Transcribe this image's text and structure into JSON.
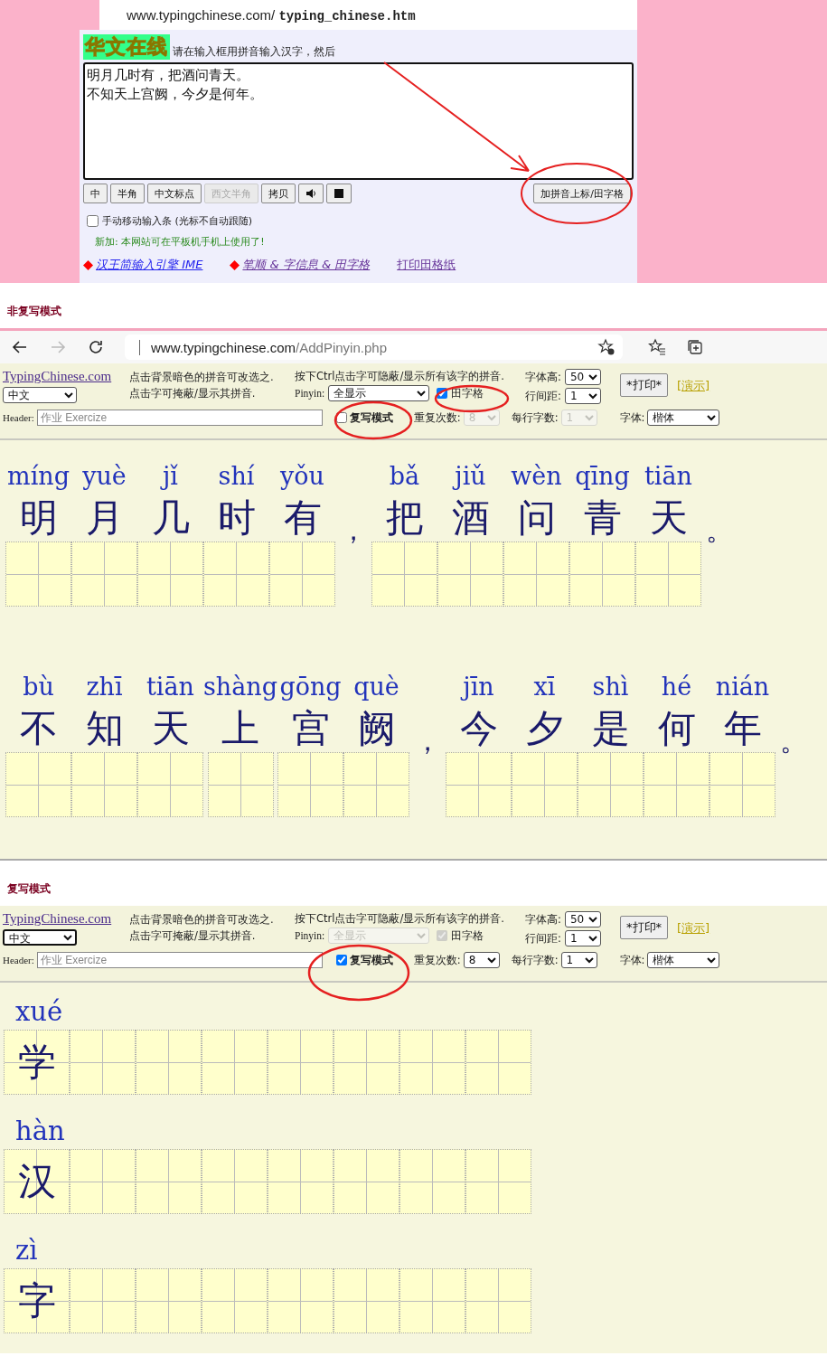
{
  "top": {
    "url_host": "www.typingchinese.com/ ",
    "url_file": "typing_chinese.htm",
    "logo": "华文在线",
    "instruction": "请在输入框用拼音输入汉字，然后",
    "text_lines": [
      "明月几时有，把酒问青天。",
      "不知天上宫阙，今夕是何年。"
    ],
    "buttons": [
      {
        "kind": "text",
        "label": "中",
        "disabled": false
      },
      {
        "kind": "text",
        "label": "半角",
        "disabled": false
      },
      {
        "kind": "text",
        "label": "中文标点",
        "disabled": false
      },
      {
        "kind": "text",
        "label": "西文半角",
        "disabled": true
      },
      {
        "kind": "text",
        "label": "拷贝",
        "disabled": false
      },
      {
        "kind": "speaker",
        "disabled": false
      },
      {
        "kind": "stop",
        "disabled": false
      }
    ],
    "add_button": "加拼音上标/田字格",
    "manual_move": {
      "label": "手动移动输入条 (光标不自动跟随)",
      "checked": false
    },
    "notice": "新加: 本网站可在平板机手机上使用了!",
    "links": [
      {
        "text": "汉王简输入引擎 IME",
        "marked": true
      },
      {
        "text": "笔顺 & 字信息 & 田字格",
        "marked": true
      },
      {
        "text": "打印田格纸",
        "marked": false
      }
    ]
  },
  "sections": [
    {
      "heading": "非复写模式",
      "browser": {
        "url_host": "www.typingchinese.com",
        "url_path": "/AddPinyin.php"
      },
      "toolbar": {
        "site_link": "TypingChinese.com",
        "language": {
          "value": "中文",
          "focused": false
        },
        "hint_1": "点击背景暗色的拼音可改选之.",
        "hint_2": "点击字可掩蔽/显示其拼音.",
        "ctrl_hint": "按下Ctrl点击字可隐蔽/显示所有该字的拼音.",
        "pinyin_label": "Pinyin:",
        "pinyin_mode": {
          "value": "全显示",
          "disabled": false
        },
        "grid_box": {
          "label": "田字格",
          "checked": true,
          "disabled": false
        },
        "font_size_label": "字体高:",
        "font_size": "50",
        "line_spacing_label": "行间距:",
        "line_spacing": "1",
        "print_button": "*打印*",
        "demo_link": "[演示]",
        "header_label": "Header:",
        "header_field": {
          "placeholder": "作业 Exercize"
        },
        "copy_mode": {
          "label": "复写模式",
          "checked": false
        },
        "repeat_label": "重复次数:",
        "repeat": {
          "value": "8",
          "disabled": true
        },
        "per_line_label": "每行字数:",
        "per_line": {
          "value": "1",
          "disabled": true
        },
        "font_label": "字体:",
        "font": "楷体"
      },
      "lines": [
        [
          {
            "kind": "hanzi",
            "pinyin": "míng",
            "char": "明"
          },
          {
            "kind": "hanzi",
            "pinyin": "yuè",
            "char": "月"
          },
          {
            "kind": "hanzi",
            "pinyin": "jǐ",
            "char": "几"
          },
          {
            "kind": "hanzi",
            "pinyin": "shí",
            "char": "时"
          },
          {
            "kind": "hanzi",
            "pinyin": "yǒu",
            "char": "有"
          },
          {
            "kind": "punct",
            "char": "，"
          },
          {
            "kind": "hanzi",
            "pinyin": "bǎ",
            "char": "把"
          },
          {
            "kind": "hanzi",
            "pinyin": "jiǔ",
            "char": "酒"
          },
          {
            "kind": "hanzi",
            "pinyin": "wèn",
            "char": "问"
          },
          {
            "kind": "hanzi",
            "pinyin": "qīng",
            "char": "青"
          },
          {
            "kind": "hanzi",
            "pinyin": "tiān",
            "char": "天"
          },
          {
            "kind": "punct",
            "char": "。"
          }
        ],
        [
          {
            "kind": "hanzi",
            "pinyin": "bù",
            "char": "不"
          },
          {
            "kind": "hanzi",
            "pinyin": "zhī",
            "char": "知"
          },
          {
            "kind": "hanzi",
            "pinyin": "tiān",
            "char": "天"
          },
          {
            "kind": "hanzi",
            "pinyin": "shàng",
            "char": "上"
          },
          {
            "kind": "hanzi",
            "pinyin": "gōng",
            "char": "宫"
          },
          {
            "kind": "hanzi",
            "pinyin": "què",
            "char": "阙"
          },
          {
            "kind": "punct",
            "char": "，"
          },
          {
            "kind": "hanzi",
            "pinyin": "jīn",
            "char": "今"
          },
          {
            "kind": "hanzi",
            "pinyin": "xī",
            "char": "夕"
          },
          {
            "kind": "hanzi",
            "pinyin": "shì",
            "char": "是"
          },
          {
            "kind": "hanzi",
            "pinyin": "hé",
            "char": "何"
          },
          {
            "kind": "hanzi",
            "pinyin": "nián",
            "char": "年"
          },
          {
            "kind": "punct",
            "char": "。"
          }
        ]
      ]
    },
    {
      "heading": "复写模式",
      "toolbar": {
        "site_link": "TypingChinese.com",
        "language": {
          "value": "中文",
          "focused": true
        },
        "hint_1": "点击背景暗色的拼音可改选之.",
        "hint_2": "点击字可掩蔽/显示其拼音.",
        "ctrl_hint": "按下Ctrl点击字可隐蔽/显示所有该字的拼音.",
        "pinyin_label": "Pinyin:",
        "pinyin_mode": {
          "value": "全显示",
          "disabled": true
        },
        "grid_box": {
          "label": "田字格",
          "checked": true,
          "disabled": true
        },
        "font_size_label": "字体高:",
        "font_size": "50",
        "line_spacing_label": "行间距:",
        "line_spacing": "1",
        "print_button": "*打印*",
        "demo_link": "[演示]",
        "header_label": "Header:",
        "header_field": {
          "placeholder": "作业 Exercize"
        },
        "copy_mode": {
          "label": "复写模式",
          "checked": true
        },
        "repeat_label": "重复次数:",
        "repeat": {
          "value": "8",
          "disabled": false
        },
        "per_line_label": "每行字数:",
        "per_line": {
          "value": "1",
          "disabled": false
        },
        "font_label": "字体:",
        "font": "楷体"
      },
      "practice": [
        {
          "pinyin": "xué",
          "char": "学"
        },
        {
          "pinyin": "hàn",
          "char": "汉"
        },
        {
          "pinyin": "zì",
          "char": "字"
        }
      ]
    }
  ]
}
